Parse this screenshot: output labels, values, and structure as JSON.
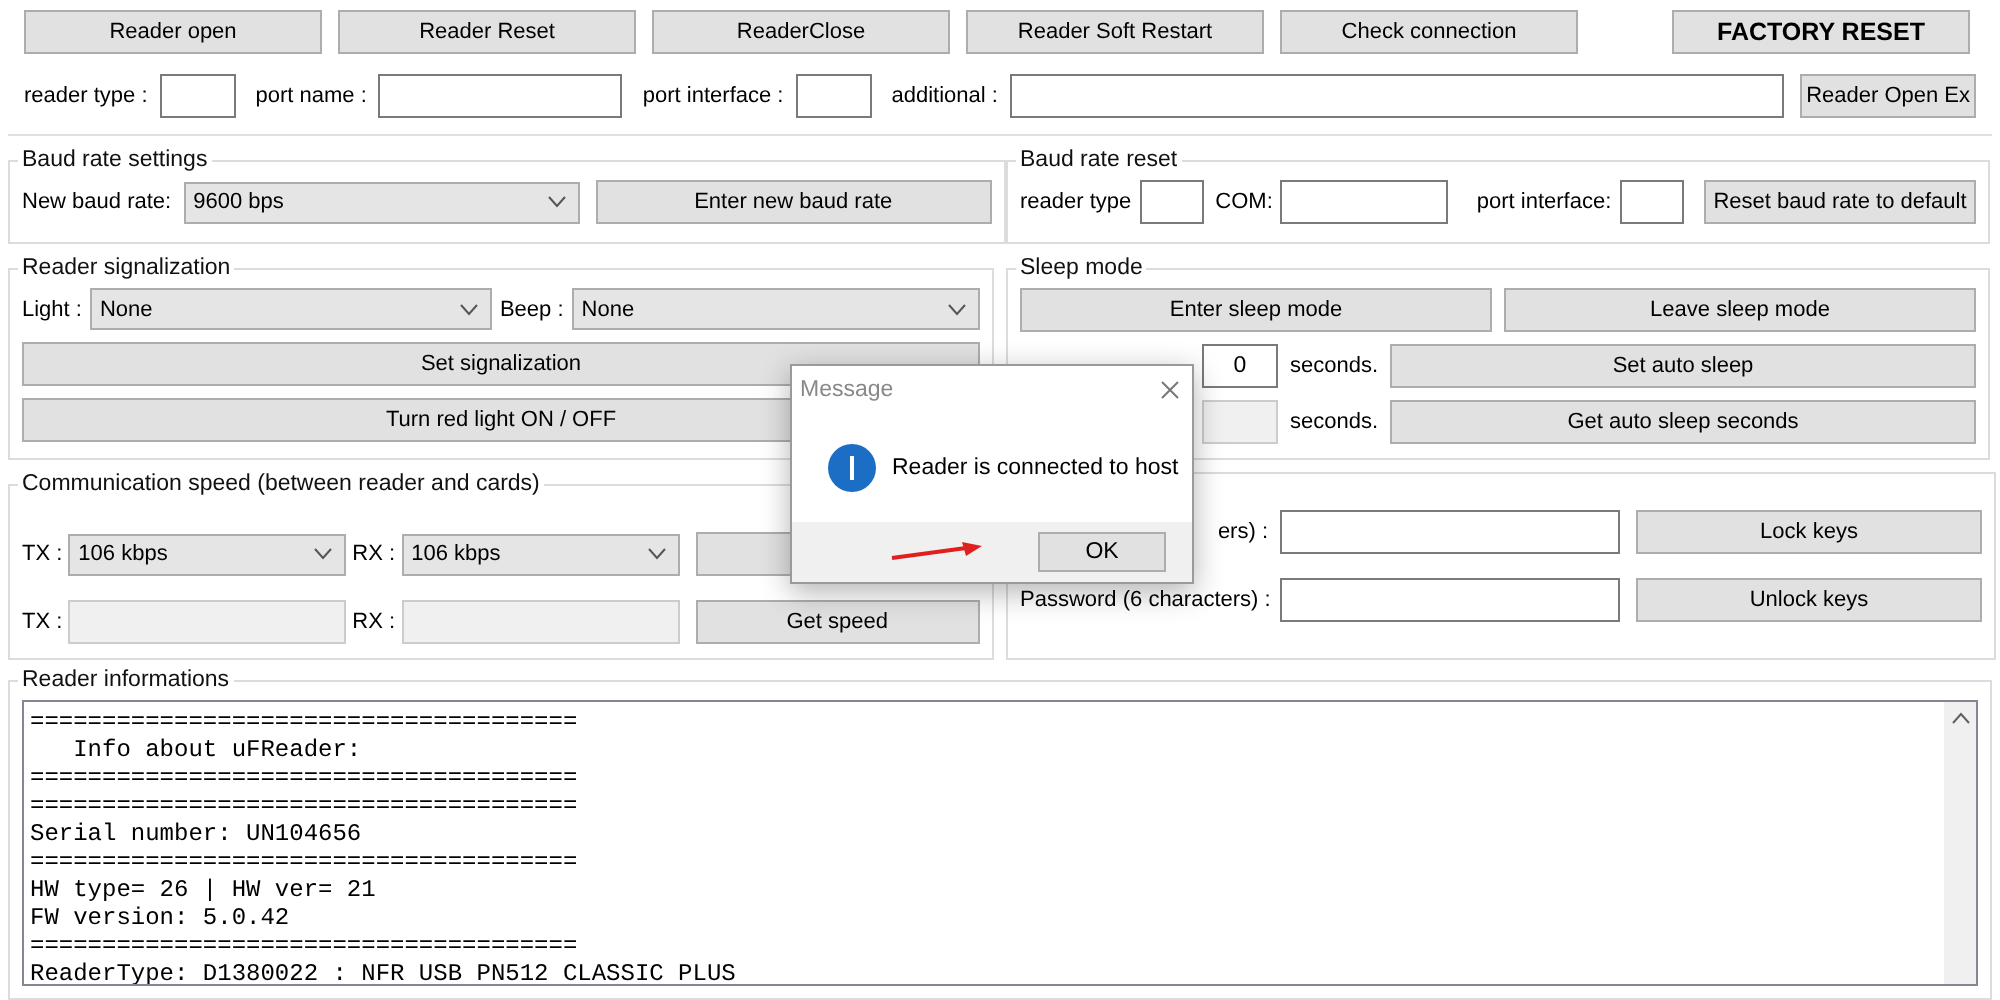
{
  "toolbar": {
    "buttons": [
      "Reader open",
      "Reader Reset",
      "ReaderClose",
      "Reader Soft Restart",
      "Check connection",
      "FACTORY RESET"
    ],
    "fields": [
      {
        "label": "reader type :"
      },
      {
        "label": "port name :"
      },
      {
        "label": "port interface :"
      },
      {
        "label": "additional :"
      }
    ],
    "open_ex_button": "Reader Open Ex"
  },
  "baud_rate_settings": {
    "title": "Baud rate settings",
    "label": "New baud rate:",
    "select": "9600 bps",
    "button": "Enter new baud rate"
  },
  "baud_rate_reset": {
    "title": "Baud rate reset",
    "fields": [
      {
        "label": "reader type"
      },
      {
        "label": "COM:"
      },
      {
        "label": "port interface:"
      }
    ],
    "button": "Reset baud rate to default"
  },
  "reader_signalization": {
    "title": "Reader signalization",
    "light_label": "Light :",
    "light": "None",
    "beep_label": "Beep :",
    "beep": "None",
    "buttons": [
      "Set signalization",
      "Turn red light ON / OFF"
    ]
  },
  "sleep_mode": {
    "title": "Sleep mode",
    "buttons": [
      "Enter sleep mode",
      "Leave sleep mode"
    ],
    "rows": [
      {
        "value": "0",
        "disabled": false,
        "unit": "seconds.",
        "button": "Set auto sleep"
      },
      {
        "disabled": true,
        "unit": "seconds.",
        "button": "Get auto sleep seconds"
      }
    ]
  },
  "communication_speed": {
    "title": "Communication speed (between reader and cards)",
    "tx_label": "TX :",
    "tx": "106 kbps",
    "rx_label": "RX :",
    "rx": "106 kbps",
    "tx_field_label": "TX :",
    "rx_field_label": "RX :",
    "get_button": "Get speed"
  },
  "keys": {
    "rows": [
      {
        "label": "ers) :",
        "button": "Lock keys"
      },
      {
        "label": "Password (6 characters) :",
        "button": "Unlock keys"
      }
    ]
  },
  "reader_info": {
    "title": "Reader informations",
    "lines": [
      "======================================",
      "   Info about uFReader:",
      "======================================",
      "======================================",
      "Serial number: UN104656",
      "======================================",
      "HW type= 26 | HW ver= 21",
      "FW version: 5.0.42",
      "======================================",
      "ReaderType: D1380022 : NFR USB PN512 CLASSIC PLUS"
    ]
  },
  "dialog": {
    "title": "Message",
    "message": "Reader is connected to host",
    "button": "OK"
  }
}
